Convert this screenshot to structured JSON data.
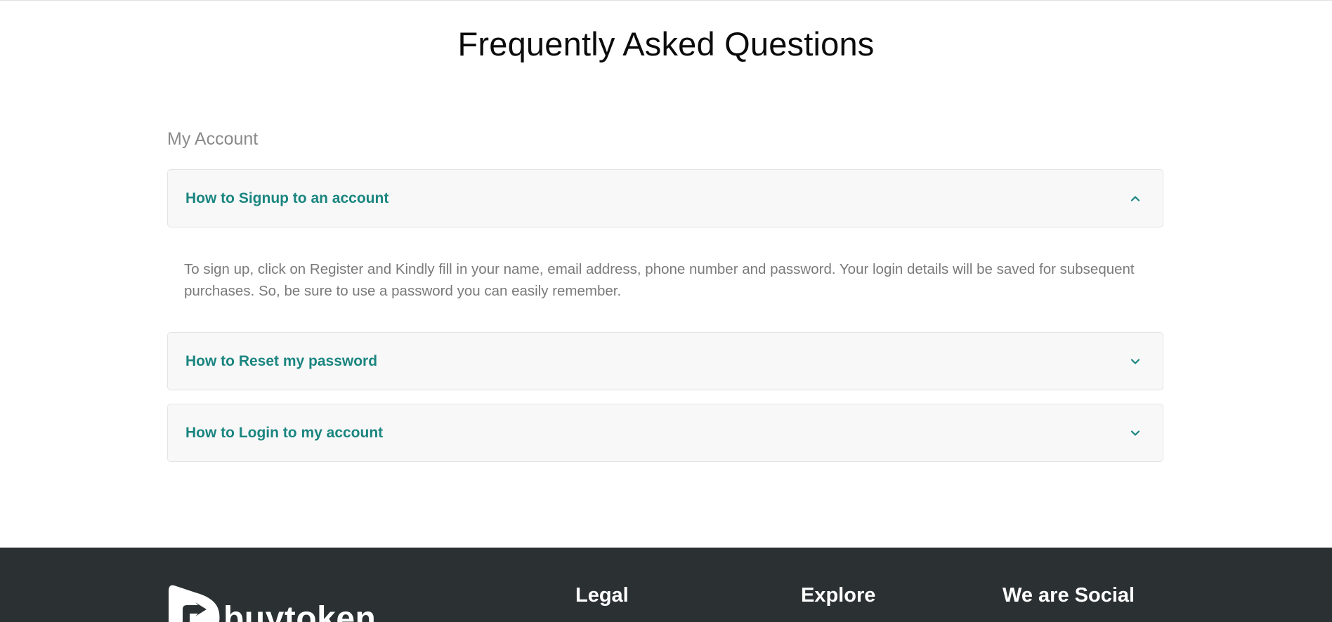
{
  "page": {
    "title": "Frequently Asked Questions"
  },
  "faq": {
    "section_title": "My Account",
    "items": [
      {
        "question": "How to Signup to an account",
        "expanded": true,
        "icon": "chevron-up-icon",
        "answer": "To sign up, click on Register and Kindly fill in your name, email address, phone number and password. Your login details will be saved for subsequent purchases. So, be sure to use a password you can easily remember."
      },
      {
        "question": "How to Reset my password",
        "expanded": false,
        "icon": "chevron-down-icon"
      },
      {
        "question": "How to Login to my account",
        "expanded": false,
        "icon": "chevron-down-icon"
      }
    ]
  },
  "footer": {
    "logo_text": "buytoken",
    "headings": {
      "legal": "Legal",
      "explore": "Explore",
      "social": "We are Social"
    }
  },
  "colors": {
    "accent": "#1b8580",
    "footer_bg": "#2b3033",
    "muted_text": "#7a7a7a"
  }
}
